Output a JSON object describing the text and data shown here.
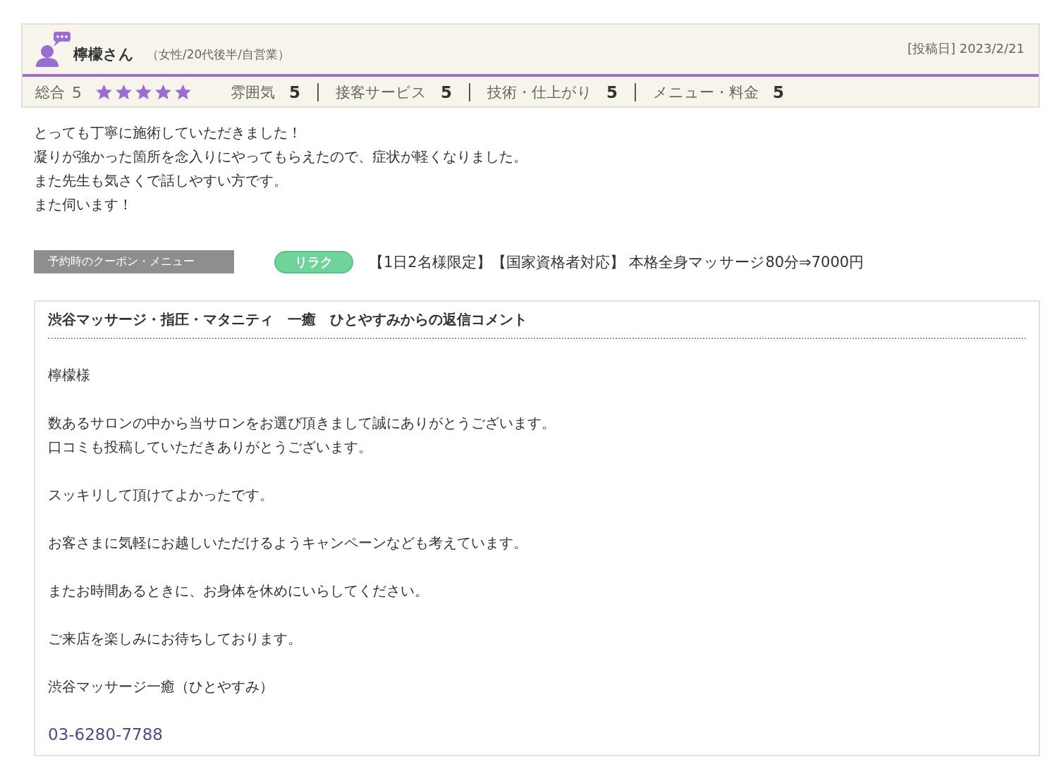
{
  "reviewer": {
    "name": "檸檬さん",
    "profile": "（女性/20代後半/自営業）",
    "posted": "[投稿日] 2023/2/21"
  },
  "ratings": {
    "overall_label": "総合",
    "overall_score": "5",
    "stars": 5,
    "categories": [
      {
        "label": "雰囲気",
        "score": "5"
      },
      {
        "label": "接客サービス",
        "score": "5"
      },
      {
        "label": "技術・仕上がり",
        "score": "5"
      },
      {
        "label": "メニュー・料金",
        "score": "5"
      }
    ]
  },
  "review_lines": [
    "とっても丁寧に施術していただきました！",
    "凝りが強かった箇所を念入りにやってもらえたので、症状が軽くなりました。",
    "また先生も気さくで話しやすい方です。",
    "また伺います！"
  ],
  "coupon": {
    "label": "予約時のクーポン・メニュー",
    "tag": "リラク",
    "menu": "【1日2名様限定】【国家資格者対応】 本格全身マッサージ80分⇒7000円"
  },
  "reply": {
    "title": "渋谷マッサージ・指圧・マタニティ　一癒　ひとやすみからの返信コメント",
    "paragraphs": [
      [
        "檸檬様"
      ],
      [
        "数あるサロンの中から当サロンをお選び頂きまして誠にありがとうございます。",
        "口コミも投稿していただきありがとうございます。"
      ],
      [
        "スッキリして頂けてよかったです。"
      ],
      [
        "お客さまに気軽にお越しいただけるようキャンペーンなども考えています。"
      ],
      [
        "またお時間あるときに、お身体を休めにいらしてください。"
      ],
      [
        "ご来店を楽しみにお待ちしております。"
      ],
      [
        "渋谷マッサージ一癒（ひとやすみ）"
      ]
    ],
    "phone": "03-6280-7788"
  }
}
